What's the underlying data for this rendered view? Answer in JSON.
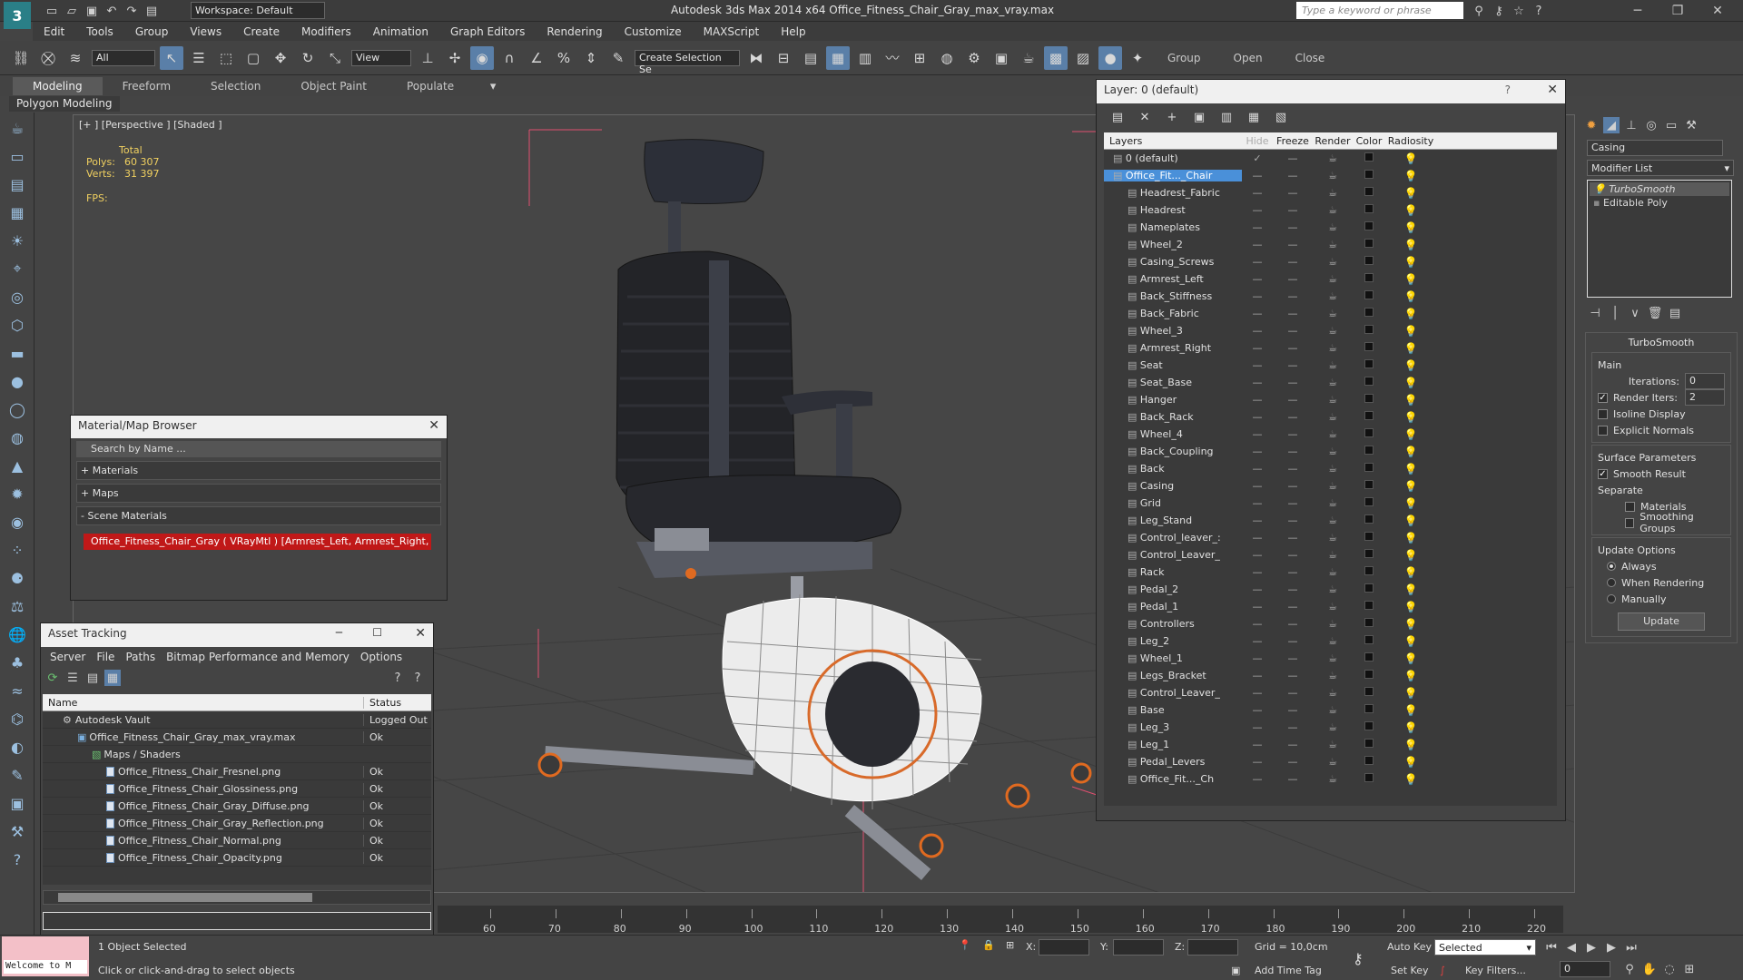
{
  "window": {
    "title": "Autodesk 3ds Max  2014 x64     Office_Fitness_Chair_Gray_max_vray.max",
    "workspace": "Workspace: Default",
    "search_placeholder": "Type a keyword or phrase"
  },
  "menu": [
    "Edit",
    "Tools",
    "Group",
    "Views",
    "Create",
    "Modifiers",
    "Animation",
    "Graph Editors",
    "Rendering",
    "Customize",
    "MAXScript",
    "Help"
  ],
  "toolbar": {
    "filter_select": "All",
    "view_select": "View",
    "create_selection": "Create Selection Se",
    "group_label": "Group",
    "open_label": "Open",
    "close_label": "Close"
  },
  "ribbon": {
    "tabs": [
      "Modeling",
      "Freeform",
      "Selection",
      "Object Paint",
      "Populate"
    ],
    "sub_label": "Polygon Modeling"
  },
  "viewport": {
    "label": "[+ ] [Perspective ] [Shaded ]",
    "stats_header": "Total",
    "polys_label": "Polys:",
    "polys_value": "60 307",
    "verts_label": "Verts:",
    "verts_value": "31 397",
    "fps_label": "FPS:"
  },
  "material_browser": {
    "title": "Material/Map Browser",
    "search_placeholder": "Search by Name ...",
    "sections": [
      "+ Materials",
      "+ Maps",
      "- Scene Materials"
    ],
    "scene_material": "Office_Fitness_Chair_Gray  ( VRayMtl ) [Armrest_Left, Armrest_Right, ..."
  },
  "asset_tracking": {
    "title": "Asset Tracking",
    "menu": [
      "Server",
      "File",
      "Paths",
      "Bitmap Performance and Memory",
      "Options"
    ],
    "col_name": "Name",
    "col_status": "Status",
    "rows": [
      {
        "name": "Autodesk Vault",
        "status": "Logged Out ..."
      },
      {
        "name": "Office_Fitness_Chair_Gray_max_vray.max",
        "status": "Ok"
      },
      {
        "name": "Maps / Shaders",
        "status": ""
      },
      {
        "name": "Office_Fitness_Chair_Fresnel.png",
        "status": "Ok"
      },
      {
        "name": "Office_Fitness_Chair_Glossiness.png",
        "status": "Ok"
      },
      {
        "name": "Office_Fitness_Chair_Gray_Diffuse.png",
        "status": "Ok"
      },
      {
        "name": "Office_Fitness_Chair_Gray_Reflection.png",
        "status": "Ok"
      },
      {
        "name": "Office_Fitness_Chair_Normal.png",
        "status": "Ok"
      },
      {
        "name": "Office_Fitness_Chair_Opacity.png",
        "status": "Ok"
      }
    ]
  },
  "layer_manager": {
    "title": "Layer: 0 (default)",
    "help": "?",
    "columns": [
      "Layers",
      "Hide",
      "Freeze",
      "Render",
      "Color",
      "Radiosity"
    ],
    "layers": [
      "0 (default)",
      "Office_Fit..._Chair",
      "Headrest_Fabric",
      "Headrest",
      "Nameplates",
      "Wheel_2",
      "Casing_Screws",
      "Armrest_Left",
      "Back_Stiffness",
      "Back_Fabric",
      "Wheel_3",
      "Armrest_Right",
      "Seat",
      "Seat_Base",
      "Hanger",
      "Back_Rack",
      "Wheel_4",
      "Back_Coupling",
      "Back",
      "Casing",
      "Grid",
      "Leg_Stand",
      "Control_leaver_:",
      "Control_Leaver_",
      "Rack",
      "Pedal_2",
      "Pedal_1",
      "Controllers",
      "Leg_2",
      "Wheel_1",
      "Legs_Bracket",
      "Control_Leaver_",
      "Base",
      "Leg_3",
      "Leg_1",
      "Pedal_Levers",
      "Office_Fit..._Ch"
    ]
  },
  "command_panel": {
    "object_name": "Casing",
    "modifier_list": "Modifier List",
    "stack": [
      "TurboSmooth",
      "Editable Poly"
    ],
    "rollout_title": "TurboSmooth",
    "main_label": "Main",
    "iterations_label": "Iterations:",
    "iterations_value": "0",
    "render_iters_label": "Render Iters:",
    "render_iters_value": "2",
    "isoline_label": "Isoline Display",
    "explicit_label": "Explicit Normals",
    "surface_label": "Surface Parameters",
    "smooth_label": "Smooth Result",
    "separate_label": "Separate",
    "materials_label": "Materials",
    "smoothing_label": "Smoothing Groups",
    "update_options_label": "Update Options",
    "always_label": "Always",
    "when_rendering_label": "When Rendering",
    "manually_label": "Manually",
    "update_button": "Update"
  },
  "timeline": {
    "ticks": [
      "60",
      "70",
      "80",
      "90",
      "100",
      "110",
      "120",
      "130",
      "140",
      "150",
      "160",
      "170",
      "180",
      "190",
      "200",
      "210",
      "220"
    ]
  },
  "status": {
    "welcome": "Welcome to M",
    "selected": "1 Object Selected",
    "hint": "Click or click-and-drag to select objects",
    "x_label": "X:",
    "y_label": "Y:",
    "z_label": "Z:",
    "grid": "Grid = 10,0cm",
    "add_time_tag": "Add Time Tag",
    "auto_key": "Auto Key",
    "set_key": "Set Key",
    "selected_dropdown": "Selected",
    "key_filters": "Key Filters...",
    "frame_value": "0"
  }
}
